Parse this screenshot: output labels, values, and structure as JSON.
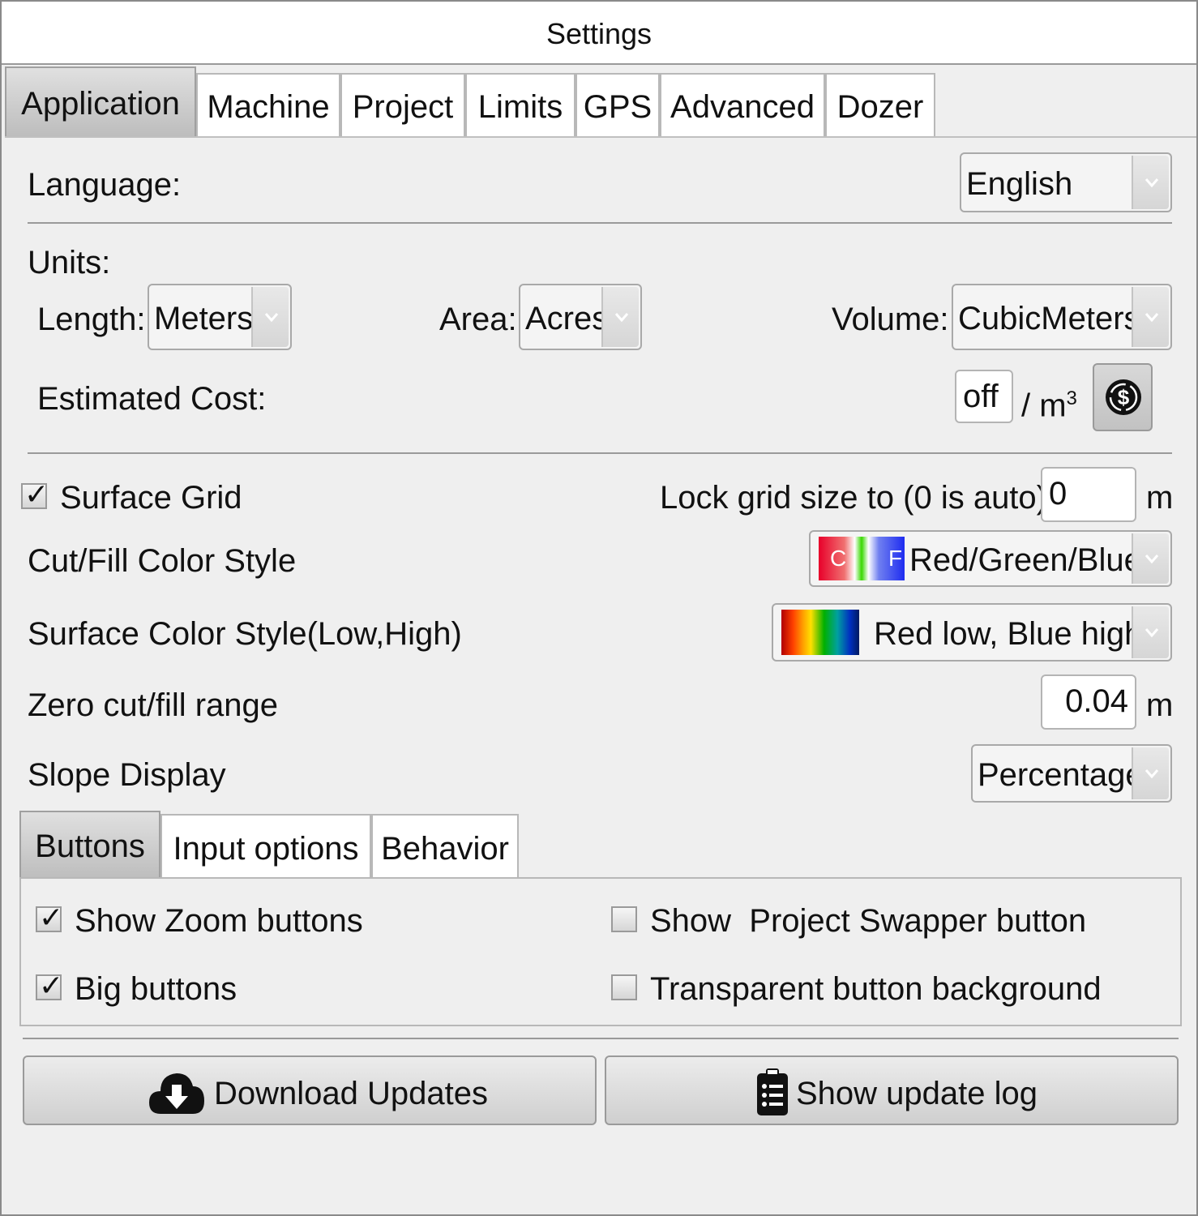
{
  "window": {
    "title": "Settings"
  },
  "tabs": [
    "Application",
    "Machine",
    "Project",
    "Limits",
    "GPS",
    "Advanced",
    "Dozer"
  ],
  "language": {
    "label": "Language:",
    "value": "English"
  },
  "units": {
    "label": "Units:",
    "length_label": "Length:",
    "length_value": "Meters",
    "area_label": "Area:",
    "area_value": "Acres",
    "volume_label": "Volume:",
    "volume_value": "CubicMeters"
  },
  "cost": {
    "label": "Estimated Cost:",
    "value": "off",
    "unit_prefix": "/ m",
    "unit_sup": "3",
    "icon": "dollar-cycle-icon"
  },
  "surface_grid": {
    "label": "Surface Grid",
    "checked": true,
    "lock_label": "Lock grid size to (0 is auto):",
    "lock_value": "0",
    "unit": "m"
  },
  "cutfill_style": {
    "label": "Cut/Fill Color Style",
    "swatch_c": "C",
    "swatch_f": "F",
    "value": "Red/Green/Blue"
  },
  "surface_style": {
    "label": "Surface Color Style(Low,High)",
    "value": "Red low, Blue high"
  },
  "zero_range": {
    "label": "Zero cut/fill range",
    "value": "0.04",
    "unit": "m"
  },
  "slope": {
    "label": "Slope Display",
    "value": "Percentage"
  },
  "subtabs": [
    "Buttons",
    "Input options",
    "Behavior"
  ],
  "options": {
    "zoom": {
      "label": "Show Zoom buttons",
      "checked": true
    },
    "big": {
      "label": "Big buttons",
      "checked": true
    },
    "swapper": {
      "label": "Show  Project Swapper button",
      "checked": false
    },
    "transparent": {
      "label": "Transparent button background",
      "checked": false
    }
  },
  "actions": {
    "download": "Download Updates",
    "log": "Show update log"
  },
  "colors": {
    "accent_gray": "#c4c4c4",
    "panel": "#efefef",
    "cut_red": "#e8002a",
    "fill_blue": "#1e2cf0"
  }
}
